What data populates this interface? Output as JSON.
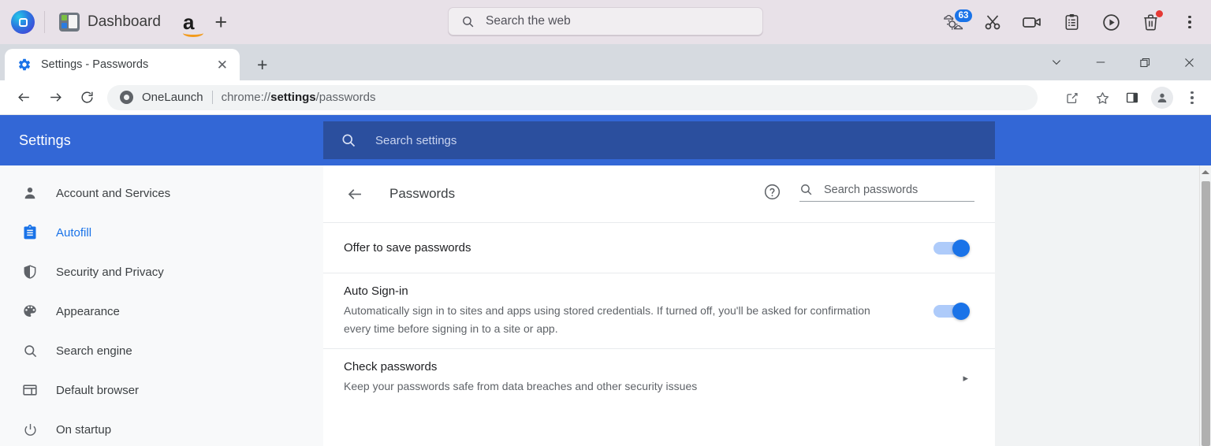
{
  "dock": {
    "logo_icon": "onelaunch-logo-icon",
    "app_label": "Dashboard",
    "app_icon": "dashboard-icon",
    "amazon_icon": "amazon-icon",
    "add_label": "+",
    "search": {
      "placeholder": "Search the web",
      "icon": "search-icon"
    },
    "icons": [
      {
        "name": "weather-icon",
        "badge": "63"
      },
      {
        "name": "scissors-icon",
        "badge": ""
      },
      {
        "name": "video-camera-icon",
        "badge": ""
      },
      {
        "name": "clipboard-icon",
        "badge": ""
      },
      {
        "name": "media-play-icon",
        "badge": ""
      },
      {
        "name": "trash-icon",
        "badge": ""
      },
      {
        "name": "more-options-icon",
        "badge": ""
      }
    ]
  },
  "browser": {
    "tab": {
      "title": "Settings - Passwords",
      "favicon": "settings-gear-icon",
      "close_label": "✕"
    },
    "new_tab_label": "+",
    "window_controls": {
      "collapse": "⌄",
      "minimize": "—",
      "restore": "❐",
      "close": "✕"
    },
    "omnibox": {
      "brand": "OneLaunch",
      "url_prefix": "chrome://",
      "url_bold": "settings",
      "url_suffix": "/passwords"
    },
    "nav": {
      "back": "back-icon",
      "forward": "forward-icon",
      "reload": "reload-icon"
    },
    "actions": [
      "share-icon",
      "bookmark-star-icon",
      "side-panel-icon",
      "profile-avatar-icon",
      "chrome-menu-icon"
    ]
  },
  "settings": {
    "brand": "Settings",
    "search": {
      "placeholder": "Search settings",
      "icon": "search-icon"
    },
    "sidebar": [
      {
        "label": "Account and Services",
        "icon": "person-icon",
        "active": false
      },
      {
        "label": "Autofill",
        "icon": "autofill-clipboard-icon",
        "active": true
      },
      {
        "label": "Security and Privacy",
        "icon": "shield-icon",
        "active": false
      },
      {
        "label": "Appearance",
        "icon": "palette-icon",
        "active": false
      },
      {
        "label": "Search engine",
        "icon": "search-icon",
        "active": false
      },
      {
        "label": "Default browser",
        "icon": "browser-window-icon",
        "active": false
      },
      {
        "label": "On startup",
        "icon": "power-icon",
        "active": false
      }
    ],
    "page": {
      "title": "Passwords",
      "back_icon": "back-arrow-icon",
      "help_icon": "help-circle-icon",
      "password_search": {
        "placeholder": "Search passwords",
        "icon": "search-icon"
      },
      "rows": [
        {
          "title": "Offer to save passwords",
          "sub": "",
          "control": "toggle",
          "toggle_on": true
        },
        {
          "title": "Auto Sign-in",
          "sub": "Automatically sign in to sites and apps using stored credentials. If turned off, you'll be asked for confirmation every time before signing in to a site or app.",
          "control": "toggle",
          "toggle_on": true
        },
        {
          "title": "Check passwords",
          "sub": "Keep your passwords safe from data breaches and other security issues",
          "control": "chevron",
          "chevron": "▸"
        }
      ]
    }
  },
  "colors": {
    "settings_header": "#3367d6",
    "accent_blue": "#1a73e8",
    "dock_bg": "#e8e1e8",
    "tabstrip_bg": "#d6dae0"
  }
}
